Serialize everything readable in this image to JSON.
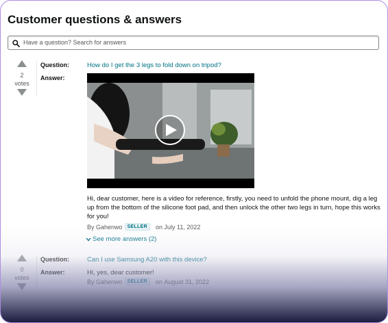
{
  "section": {
    "title": "Customer questions & answers"
  },
  "search": {
    "placeholder": "Have a question? Search for answers"
  },
  "labels": {
    "question": "Question:",
    "answer": "Answer:",
    "by": "By",
    "on": "on",
    "votes": "votes"
  },
  "items": [
    {
      "votes": "2",
      "question": "How do I get the 3 legs to fold down on tripod?",
      "has_video": true,
      "answer": "Hi, dear customer, here is a video for reference, firstly, you need to unfold the phone mount, dig a leg up from the bottom of the silicone foot pad, and then unlock the other two legs in turn, hope this works for you!",
      "author": "Gahenwo",
      "badge": "SELLER",
      "date": "July 11, 2022",
      "more_answers": "See more answers (2)"
    },
    {
      "votes": "0",
      "question": "Can I use Samsung A20 with this device?",
      "answer": "Hi, yes, dear customer!",
      "author": "Gahenwo",
      "badge": "SELLER",
      "date": "August 31, 2022"
    }
  ],
  "colors": {
    "link": "#007185",
    "text": "#0f1111",
    "muted": "#565959",
    "frame": "#a98ee0"
  },
  "icons": {
    "search": "search-icon",
    "vote_up": "triangle-up-icon",
    "vote_down": "triangle-down-icon",
    "play": "play-icon",
    "chevron": "chevron-down-icon"
  }
}
